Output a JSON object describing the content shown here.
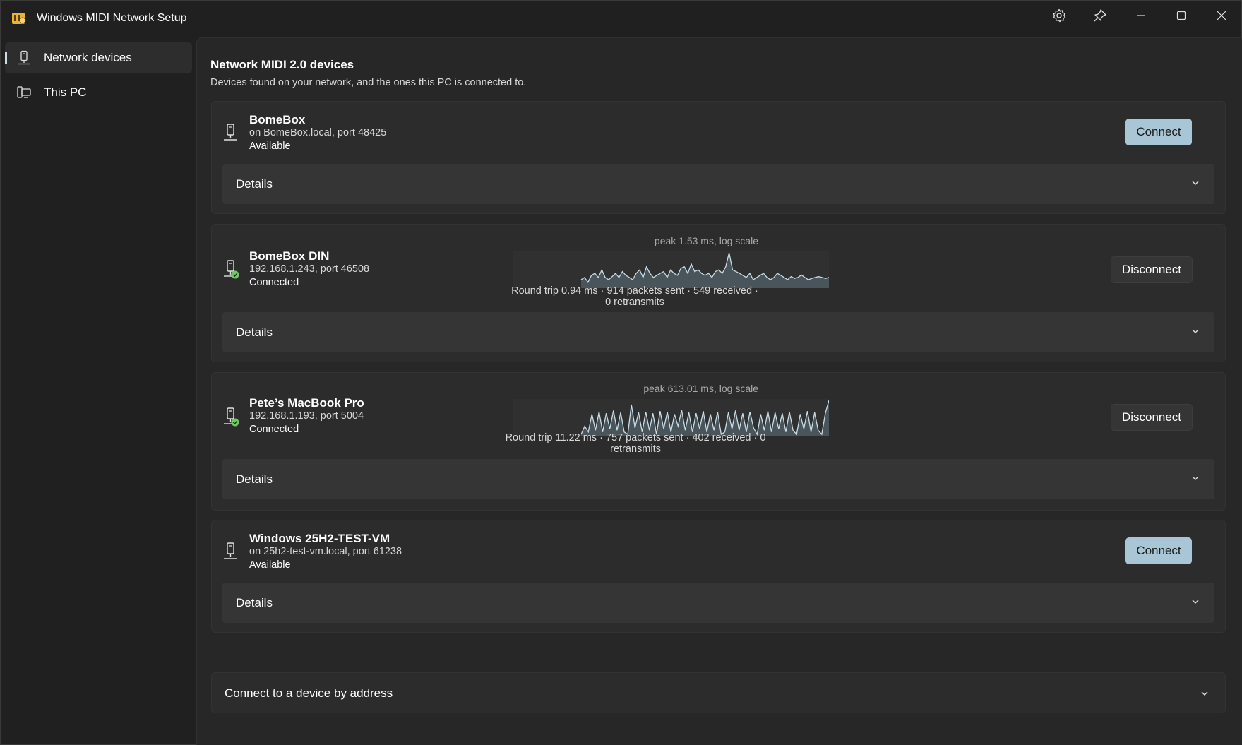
{
  "window": {
    "title": "Windows MIDI Network Setup"
  },
  "caption_buttons": [
    "settings-icon",
    "pin-icon",
    "minimize-icon",
    "maximize-icon",
    "close-icon"
  ],
  "sidebar": {
    "items": [
      {
        "label": "Network devices",
        "icon": "network-device-icon",
        "selected": true
      },
      {
        "label": "This PC",
        "icon": "this-pc-icon",
        "selected": false
      }
    ]
  },
  "main": {
    "title": "Network MIDI 2.0 devices",
    "subtitle": "Devices found on your network, and the ones this PC is connected to.",
    "devices": [
      {
        "name": "BomeBox",
        "address": "on BomeBox.local, port 48425",
        "status": "Available",
        "action": "Connect",
        "details_label": "Details"
      },
      {
        "name": "BomeBox DIN",
        "address": "192.168.1.243, port 46508",
        "status": "Connected",
        "action": "Disconnect",
        "details_label": "Details",
        "peak": "peak 1.53 ms, log scale",
        "stats": "Round trip 0.94 ms · 914 packets sent · 549 received · 0 retransmits",
        "latency_samples": [
          0.55,
          0.6,
          0.5,
          0.65,
          0.7,
          0.6,
          0.8,
          0.6,
          0.55,
          0.62,
          0.7,
          0.6,
          0.75,
          0.65,
          0.6,
          0.55,
          0.7,
          0.8,
          0.6,
          0.9,
          0.7,
          0.6,
          0.65,
          0.7,
          0.75,
          0.6,
          0.8,
          0.7,
          0.65,
          0.85,
          0.9,
          0.7,
          1.0,
          0.75,
          0.8,
          0.7,
          0.65,
          0.7,
          0.6,
          0.75,
          0.8,
          0.7,
          0.9,
          1.53,
          0.8,
          0.75,
          0.7,
          0.65,
          0.6,
          0.7,
          0.55,
          0.6,
          0.65,
          0.7,
          0.6,
          0.55,
          0.6,
          0.7,
          0.65,
          0.6,
          0.55,
          0.62,
          0.58,
          0.6,
          0.66,
          0.6,
          0.55,
          0.58,
          0.6,
          0.62,
          0.6,
          0.58,
          0.6
        ]
      },
      {
        "name": "Pete’s MacBook Pro",
        "address": "192.168.1.193, port 5004",
        "status": "Connected",
        "action": "Disconnect",
        "details_label": "Details",
        "peak": "peak 613.01 ms, log scale",
        "stats": "Round trip 11.22 ms · 757 packets sent · 402 received · 0 retransmits",
        "latency_samples": [
          2,
          8,
          3,
          60,
          4,
          90,
          3,
          70,
          5,
          110,
          4,
          80,
          3,
          2,
          300,
          6,
          80,
          3,
          90,
          4,
          70,
          2,
          100,
          5,
          90,
          3,
          60,
          8,
          120,
          4,
          80,
          3,
          70,
          5,
          100,
          3,
          60,
          4,
          90,
          2,
          3,
          80,
          5,
          110,
          4,
          70,
          3,
          90,
          6,
          2,
          60,
          4,
          100,
          3,
          80,
          5,
          70,
          3,
          90,
          4,
          2,
          60,
          5,
          100,
          3,
          80,
          4,
          2,
          70,
          613
        ]
      },
      {
        "name": "Windows 25H2-TEST-VM",
        "address": "on 25h2-test-vm.local, port 61238",
        "status": "Available",
        "action": "Connect",
        "details_label": "Details"
      }
    ],
    "connect_by_address": "Connect to a device by address"
  },
  "colors": {
    "accent": "#a9c6d6",
    "connected_badge": "#6ccb5f",
    "graph_fill": "#4a545b",
    "graph_line": "#c8dde8"
  }
}
